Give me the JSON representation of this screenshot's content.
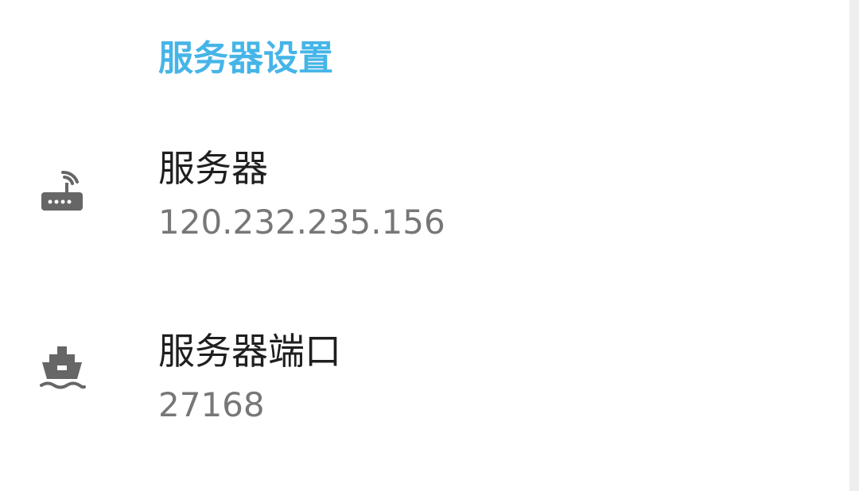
{
  "section": {
    "title": "服务器设置"
  },
  "preferences": [
    {
      "icon": "router-icon",
      "title": "服务器",
      "summary": "120.232.235.156"
    },
    {
      "icon": "ship-icon",
      "title": "服务器端口",
      "summary": "27168"
    }
  ],
  "colors": {
    "accent": "#45b5e8",
    "title_text": "#1f1f1f",
    "summary_text": "#777777",
    "icon": "#666666"
  }
}
